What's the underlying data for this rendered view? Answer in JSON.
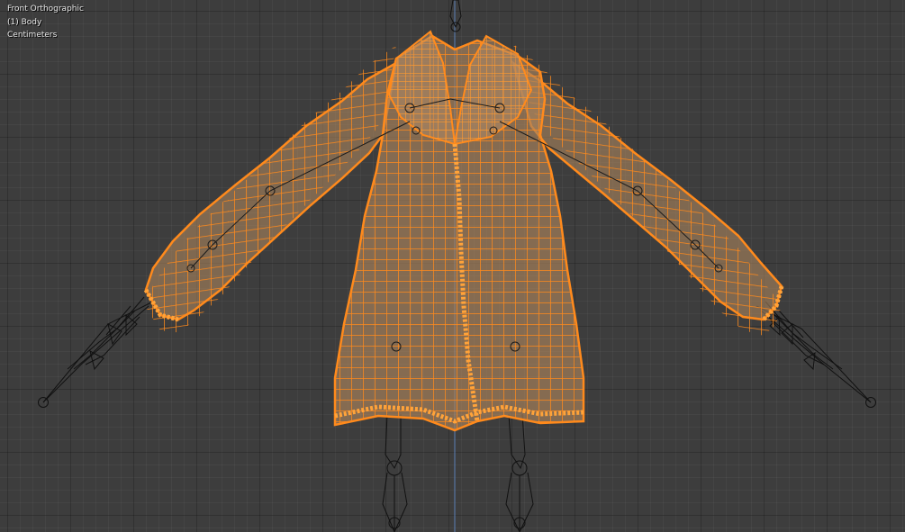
{
  "viewport": {
    "view_name": "Front Orthographic",
    "object_label": "(1) Body",
    "units": "Centimeters"
  },
  "colors": {
    "background": "#3d3d3d",
    "wire": "#ff8a1c",
    "mesh_fill": "#a8825c",
    "armature": "#111111",
    "z_axis": "#5a7fb5"
  },
  "icons": {
    "armature": "bone-wireframe-icon"
  }
}
